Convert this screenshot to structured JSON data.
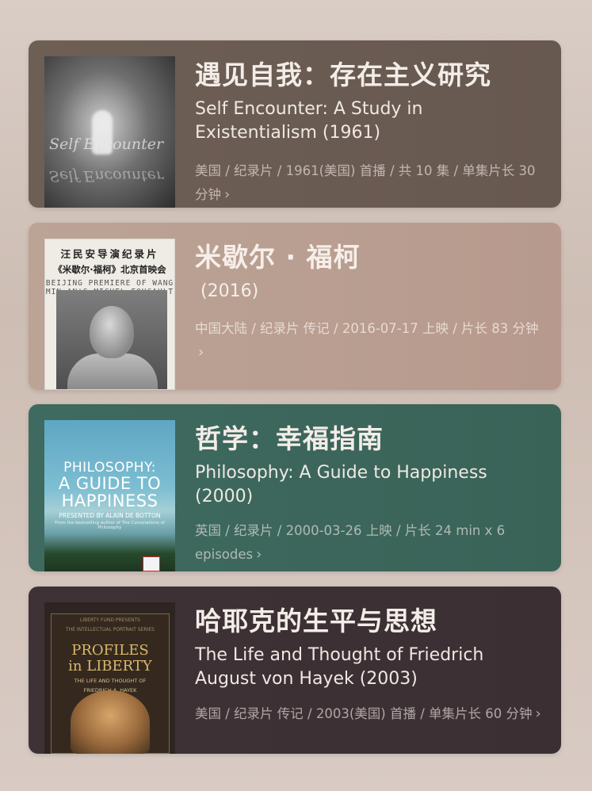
{
  "items": [
    {
      "title_cn": "遇见自我：存在主义研究",
      "title_en": "Self Encounter: A Study in Existentialism (1961)",
      "meta": "美国 / 纪录片 / 1961(美国) 首播 / 共 10 集 / 单集片长 30 分钟",
      "poster_text": "Self Encounter"
    },
    {
      "title_cn": "米歇尔 · 福柯",
      "title_en": " (2016)",
      "meta": "中国大陆 / 纪录片 传记 / 2016-07-17 上映 / 片长 83 分钟",
      "poster_lines": [
        "汪民安导演纪录片",
        "《米歇尔·福柯》北京首映会",
        "BEIJING PREMIERE OF WANG",
        "MIN-AN'S MICHEL FOUCAULT"
      ]
    },
    {
      "title_cn": "哲学：幸福指南",
      "title_en": "Philosophy: A Guide to Happiness (2000)",
      "meta": "英国 / 纪录片 / 2000-03-26 上映 / 片长 24 min x 6 episodes",
      "poster_lines": [
        "PHILOSOPHY:",
        "A GUIDE TO",
        "HAPPINESS",
        "PRESENTED BY ALAIN DE BOTTON",
        "From the bestselling author of The Consolations of Philosophy"
      ]
    },
    {
      "title_cn": "哈耶克的生平与思想",
      "title_en": "The Life and Thought of Friedrich August von Hayek (2003)",
      "meta": "美国 / 纪录片 传记 / 2003(美国) 首播 / 单集片长 60 分钟",
      "poster_lines": [
        "LIBERTY FUND PRESENTS",
        "THE INTELLECTUAL PORTRAIT SERIES",
        "PROFILES",
        "in LIBERTY",
        "THE LIFE AND THOUGHT OF",
        "FRIEDRICH A. HAYEK"
      ]
    }
  ],
  "chevron": "›"
}
